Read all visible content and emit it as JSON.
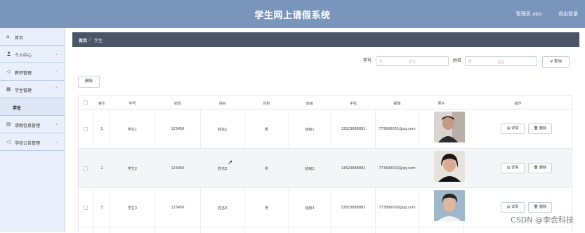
{
  "header": {
    "title": "学生网上请假系统",
    "user": "管理员 abo",
    "logout": "退出登录"
  },
  "sidebar": {
    "items": [
      {
        "label": "首页",
        "icon": "home-icon",
        "glyph": "⌂",
        "chevron": ""
      },
      {
        "label": "个人中心",
        "icon": "user-icon",
        "glyph": "👤",
        "chevron": "⌄"
      },
      {
        "label": "教师管理",
        "icon": "send-icon",
        "glyph": "◁",
        "chevron": "⌄"
      },
      {
        "label": "学生管理",
        "icon": "grid-icon",
        "glyph": "▦",
        "chevron": "⌃"
      }
    ],
    "sub_item": "学生",
    "items2": [
      {
        "label": "请假信息管理",
        "icon": "document-icon",
        "glyph": "▤",
        "chevron": "⌄"
      },
      {
        "label": "学校公告管理",
        "icon": "send-icon",
        "glyph": "◁",
        "chevron": "⌄"
      }
    ]
  },
  "breadcrumb": {
    "home": "首页",
    "sep": "/",
    "current": "学生"
  },
  "search": {
    "xuehao_label": "学号",
    "xuehao_placeholder": "学号",
    "name_label": "姓名",
    "name_placeholder": "姓名",
    "query_button": "查询"
  },
  "toolbar": {
    "delete_label": "删除"
  },
  "table": {
    "columns": [
      "索引",
      "学号",
      "密码",
      "姓名",
      "性别",
      "班级",
      "手机",
      "邮箱",
      "照片",
      "操作"
    ],
    "rows": [
      {
        "index": "1",
        "xuehao": "学生1",
        "password": "123456",
        "name": "姓名1",
        "gender": "男",
        "class": "班级1",
        "phone": "13823888881",
        "email": "773890001@qq.com"
      },
      {
        "index": "2",
        "xuehao": "学生2",
        "password": "123456",
        "name": "姓名2",
        "gender": "男",
        "class": "班级2",
        "phone": "13823888882",
        "email": "773890002@qq.com"
      },
      {
        "index": "3",
        "xuehao": "学生3",
        "password": "123456",
        "name": "姓名3",
        "gender": "男",
        "class": "班级3",
        "phone": "13823888883",
        "email": "773890003@qq.com"
      }
    ],
    "action_detail": "详情",
    "action_delete": "删除"
  },
  "watermark": "CSDN @李会科技",
  "colors": {
    "header": "#7a95bb",
    "sidebar": "#eaf0fb",
    "breadcrumb": "#4a5568"
  }
}
